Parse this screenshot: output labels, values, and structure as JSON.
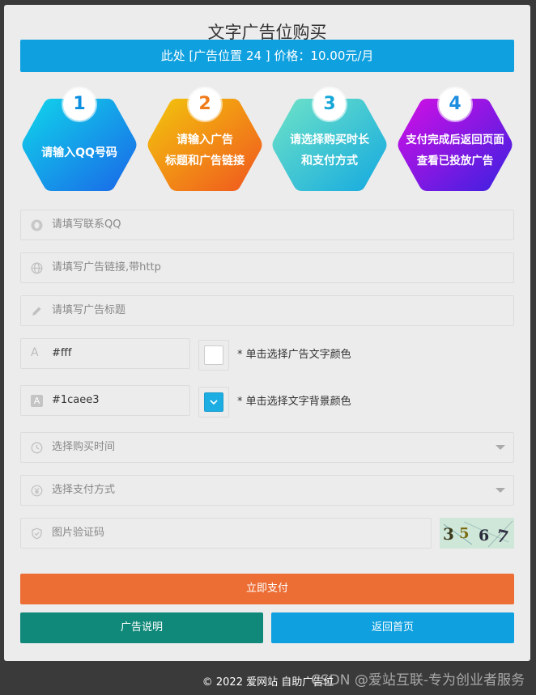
{
  "page": {
    "title": "文字广告位购买",
    "price_bar": "此处 [广告位置 24 ] 价格：10.00元/月"
  },
  "steps": [
    {
      "num": "1",
      "line1": "请输入QQ号码",
      "line2": "",
      "color": "#0b8fe0"
    },
    {
      "num": "2",
      "line1": "请输入广告",
      "line2": "标题和广告链接",
      "color": "#f07b1a"
    },
    {
      "num": "3",
      "line1": "请选择购买时长",
      "line2": "和支付方式",
      "color": "#16a7d8"
    },
    {
      "num": "4",
      "line1": "支付完成后返回页面",
      "line2": "查看已投放广告",
      "color": "#1d8de0"
    }
  ],
  "form": {
    "qq_placeholder": "请填写联系QQ",
    "link_placeholder": "请填写广告链接,带http",
    "title_placeholder": "请填写广告标题",
    "text_color_value": "#fff",
    "text_color_hint": "* 单击选择广告文字颜色",
    "bg_color_value": "#1caee3",
    "bg_color_hint": "* 单击选择文字背景颜色",
    "time_placeholder": "选择购买时间",
    "pay_placeholder": "选择支付方式",
    "captcha_placeholder": "图片验证码",
    "captcha_text": "3567"
  },
  "buttons": {
    "pay": "立即支付",
    "explain": "广告说明",
    "home": "返回首页"
  },
  "colors": {
    "primary": "#0fa0e0",
    "pay": "#ec6e35",
    "explain": "#11897a",
    "home": "#0fa0e0",
    "swatch_text": "#ffffff",
    "swatch_bg": "#1caee3"
  },
  "footer": {
    "copyright": "© 2022 爱网站 自助广告位",
    "watermark": "CSDN @爱站互联-专为创业者服务"
  }
}
